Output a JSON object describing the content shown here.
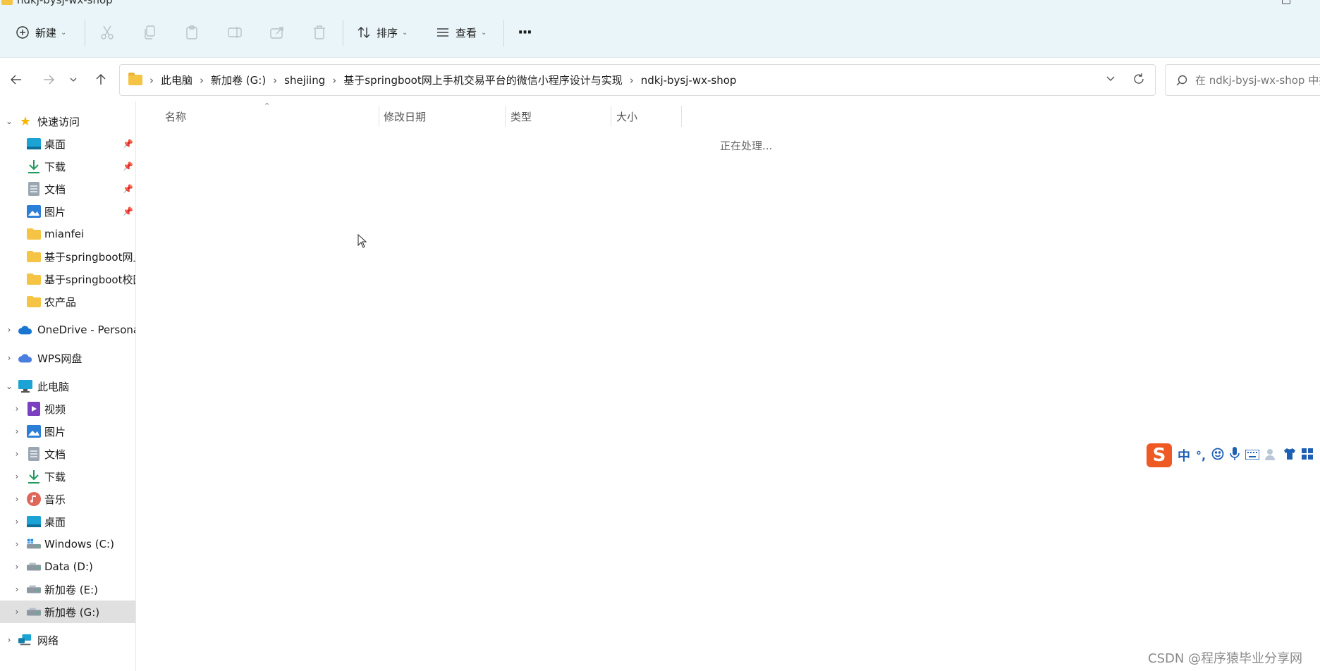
{
  "window": {
    "title": "ndkj-bysj-wx-shop"
  },
  "toolbar": {
    "new_label": "新建",
    "sort_label": "排序",
    "view_label": "查看",
    "more_label": "···"
  },
  "address": {
    "crumbs": [
      "此电脑",
      "新加卷 (G:)",
      "shejiing",
      "基于springboot网上手机交易平台的微信小程序设计与实现",
      "ndkj-bysj-wx-shop"
    ]
  },
  "search": {
    "placeholder": "在 ndkj-bysj-wx-shop 中搜索"
  },
  "sidebar": {
    "quick_access": {
      "label": "快速访问",
      "items": [
        {
          "label": "桌面",
          "pinned": true
        },
        {
          "label": "下载",
          "pinned": true
        },
        {
          "label": "文档",
          "pinned": true
        },
        {
          "label": "图片",
          "pinned": true
        },
        {
          "label": "mianfei"
        },
        {
          "label": "基于springboot网上手机交易平台的微信小程序设计与实现"
        },
        {
          "label": "基于springboot校园"
        },
        {
          "label": "农产品"
        }
      ]
    },
    "onedrive": {
      "label": "OneDrive - Personal"
    },
    "wps": {
      "label": "WPS网盘"
    },
    "this_pc": {
      "label": "此电脑",
      "items": [
        {
          "label": "视频"
        },
        {
          "label": "图片"
        },
        {
          "label": "文档"
        },
        {
          "label": "下载"
        },
        {
          "label": "音乐"
        },
        {
          "label": "桌面"
        },
        {
          "label": "Windows (C:)"
        },
        {
          "label": "Data (D:)"
        },
        {
          "label": "新加卷 (E:)"
        },
        {
          "label": "新加卷 (G:)",
          "selected": true
        }
      ]
    },
    "network": {
      "label": "网络"
    }
  },
  "content": {
    "columns": [
      "名称",
      "修改日期",
      "类型",
      "大小"
    ],
    "status_text": "正在处理..."
  },
  "ime": {
    "logo": "S",
    "mode": "中",
    "punct": "°,"
  },
  "watermark": "CSDN @程序猿毕业分享网",
  "colors": {
    "toolbar_bg": "#e9f5f8",
    "selected_bg": "#e0e0e0",
    "folder": "#f6c445",
    "ime_logo": "#ef5a24",
    "ime_icons": "#1e5fb4"
  }
}
